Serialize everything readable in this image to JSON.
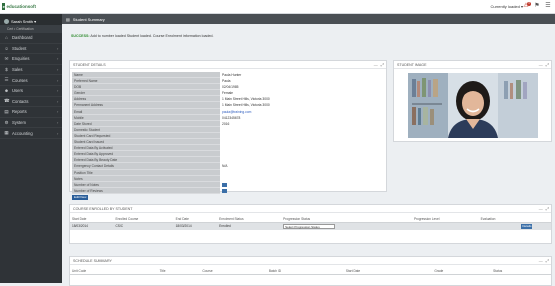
{
  "header": {
    "logo_mark": "e",
    "logo_text": "educationsoft",
    "account": "Currently loaded ▾",
    "notification_count": "3",
    "icons": [
      "bell-icon",
      "flag-icon",
      "menu-icon"
    ]
  },
  "sidebar": {
    "user": "Sarah Smith ▾",
    "status": "Cert • Certification",
    "items": [
      {
        "label": "Dashboard",
        "icon": "dashboard-icon",
        "glyph": "⌂",
        "caret": ""
      },
      {
        "label": "Student",
        "icon": "student-icon",
        "glyph": "☺",
        "caret": "›"
      },
      {
        "label": "Enquiries",
        "icon": "enquiries-icon",
        "glyph": "✉",
        "caret": "›"
      },
      {
        "label": "Sales",
        "icon": "sales-icon",
        "glyph": "$",
        "caret": "›"
      },
      {
        "label": "Courses",
        "icon": "courses-icon",
        "glyph": "☰",
        "caret": "›"
      },
      {
        "label": "Users",
        "icon": "users-icon",
        "glyph": "☻",
        "caret": "›"
      },
      {
        "label": "Contacts",
        "icon": "contacts-icon",
        "glyph": "☎",
        "caret": "›"
      },
      {
        "label": "Reports",
        "icon": "reports-icon",
        "glyph": "▤",
        "caret": "›"
      },
      {
        "label": "System",
        "icon": "system-icon",
        "glyph": "⚙",
        "caret": "›"
      },
      {
        "label": "Accounting",
        "icon": "accounting-icon",
        "glyph": "▦",
        "caret": "›"
      }
    ]
  },
  "page": {
    "title": "Student Summary",
    "alert_strong": "SUCCESS:",
    "alert_text": "Add to number loaded Student loaded. Course Enrolment information loaded."
  },
  "student_details": {
    "title": "Student Details",
    "fields": [
      {
        "label": "Name",
        "value": "Paula Hunter"
      },
      {
        "label": "Preferred Name",
        "value": "Paula"
      },
      {
        "label": "DOB",
        "value": "02/04/1985"
      },
      {
        "label": "Gender",
        "value": "Female"
      },
      {
        "label": "Address",
        "value": "1 Main Street Hills, Victoria 3000"
      },
      {
        "label": "Permanent Address",
        "value": "1 Main Street Hills, Victoria 3000"
      },
      {
        "label": "Email",
        "value": "paula@training.com",
        "link": true
      },
      {
        "label": "Mobile",
        "value": "0412345678"
      },
      {
        "label": "Date Stored",
        "value": "2016"
      },
      {
        "label": "Domestic Student",
        "value": ""
      },
      {
        "label": "Student Card Requested",
        "value": ""
      },
      {
        "label": "Student Card Issued",
        "value": ""
      },
      {
        "label": "Entered Data By Activated",
        "value": ""
      },
      {
        "label": "Entered Data By Approved",
        "value": ""
      },
      {
        "label": "Entered Data By Beauty Date",
        "value": ""
      },
      {
        "label": "Emergency Contact Details",
        "value": "N/A"
      },
      {
        "label": "Position Title",
        "value": ""
      },
      {
        "label": "Notes",
        "value": ""
      },
      {
        "label": "Number of Notes",
        "value": "",
        "mini": true
      },
      {
        "label": "Number of Reviews",
        "value": "",
        "mini": true
      }
    ],
    "button": "Edit/View"
  },
  "student_image": {
    "title": "Student Image"
  },
  "course_panel": {
    "title": "Course Enrolled by Student",
    "columns": [
      "Start Date",
      "Enrolled Course",
      "End Date",
      "Enrolment Status",
      "Progression Status",
      "Progression Level",
      "Evaluation",
      ""
    ],
    "rows": [
      {
        "start": "18/03/2014",
        "course": "CS/C",
        "end": "18/03/2014",
        "status": "Enrolled",
        "select": "Select Progression Status",
        "level": "",
        "evaluation": "",
        "action": "Details"
      }
    ]
  },
  "schedule_panel": {
    "title": "Schedule Summary",
    "columns": [
      "Unit Code",
      "Title",
      "Course",
      "Batch ID",
      "Start Date",
      "Grade",
      "Status"
    ]
  }
}
